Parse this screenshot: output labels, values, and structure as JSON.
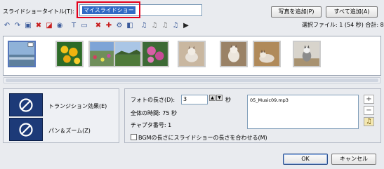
{
  "title_section": {
    "label": "スライドショータイトル(T):",
    "value": "マイスライドショー"
  },
  "buttons": {
    "add_photo": "写真を追加(P)",
    "add_all": "すべて追加(A)",
    "ok": "OK",
    "cancel": "キャンセル"
  },
  "selection_info": "選択ファイル: 1 (54 秒)  合計: 8",
  "toolbar_icons": [
    "rotate-left-icon",
    "rotate-right-icon",
    "crop-icon",
    "delete-icon",
    "frame-icon",
    "red-eye-icon",
    "text-icon",
    "select-icon",
    "effect-remove-icon",
    "effect-add-icon",
    "effect-gear-icon",
    "fx-icon",
    "audio-icon",
    "audio-remove-icon",
    "audio-edit-icon",
    "audio-add-icon",
    "play-icon"
  ],
  "thumbnails": [
    {
      "name": "landscape-photo",
      "selected": true
    },
    {
      "name": "yellow-flowers-photo",
      "selected": false
    },
    {
      "name": "garden-photo",
      "selected": false
    },
    {
      "name": "sky-photo",
      "selected": false
    },
    {
      "name": "pink-flowers-photo",
      "selected": false
    },
    {
      "name": "cat-photo-1",
      "selected": false
    },
    {
      "name": "cat-photo-2",
      "selected": false
    },
    {
      "name": "cat-photo-3",
      "selected": false
    },
    {
      "name": "cat-photo-4",
      "selected": false
    }
  ],
  "effects": {
    "transition_label": "トランジション効果(E)",
    "pan_zoom_label": "パン＆ズーム(Z)"
  },
  "settings": {
    "photo_length_label": "フォトの長さ(D):",
    "photo_length_value": "3",
    "unit": "秒",
    "total_time": "全体の時間: 75 秒",
    "chapter_number": "チャプタ番号: 1",
    "bgm_label": "BGMの長さにスライドショーの長さを合わせる(M)",
    "bgm_checked": false
  },
  "music": {
    "items": [
      "05_Music09.mp3"
    ]
  }
}
